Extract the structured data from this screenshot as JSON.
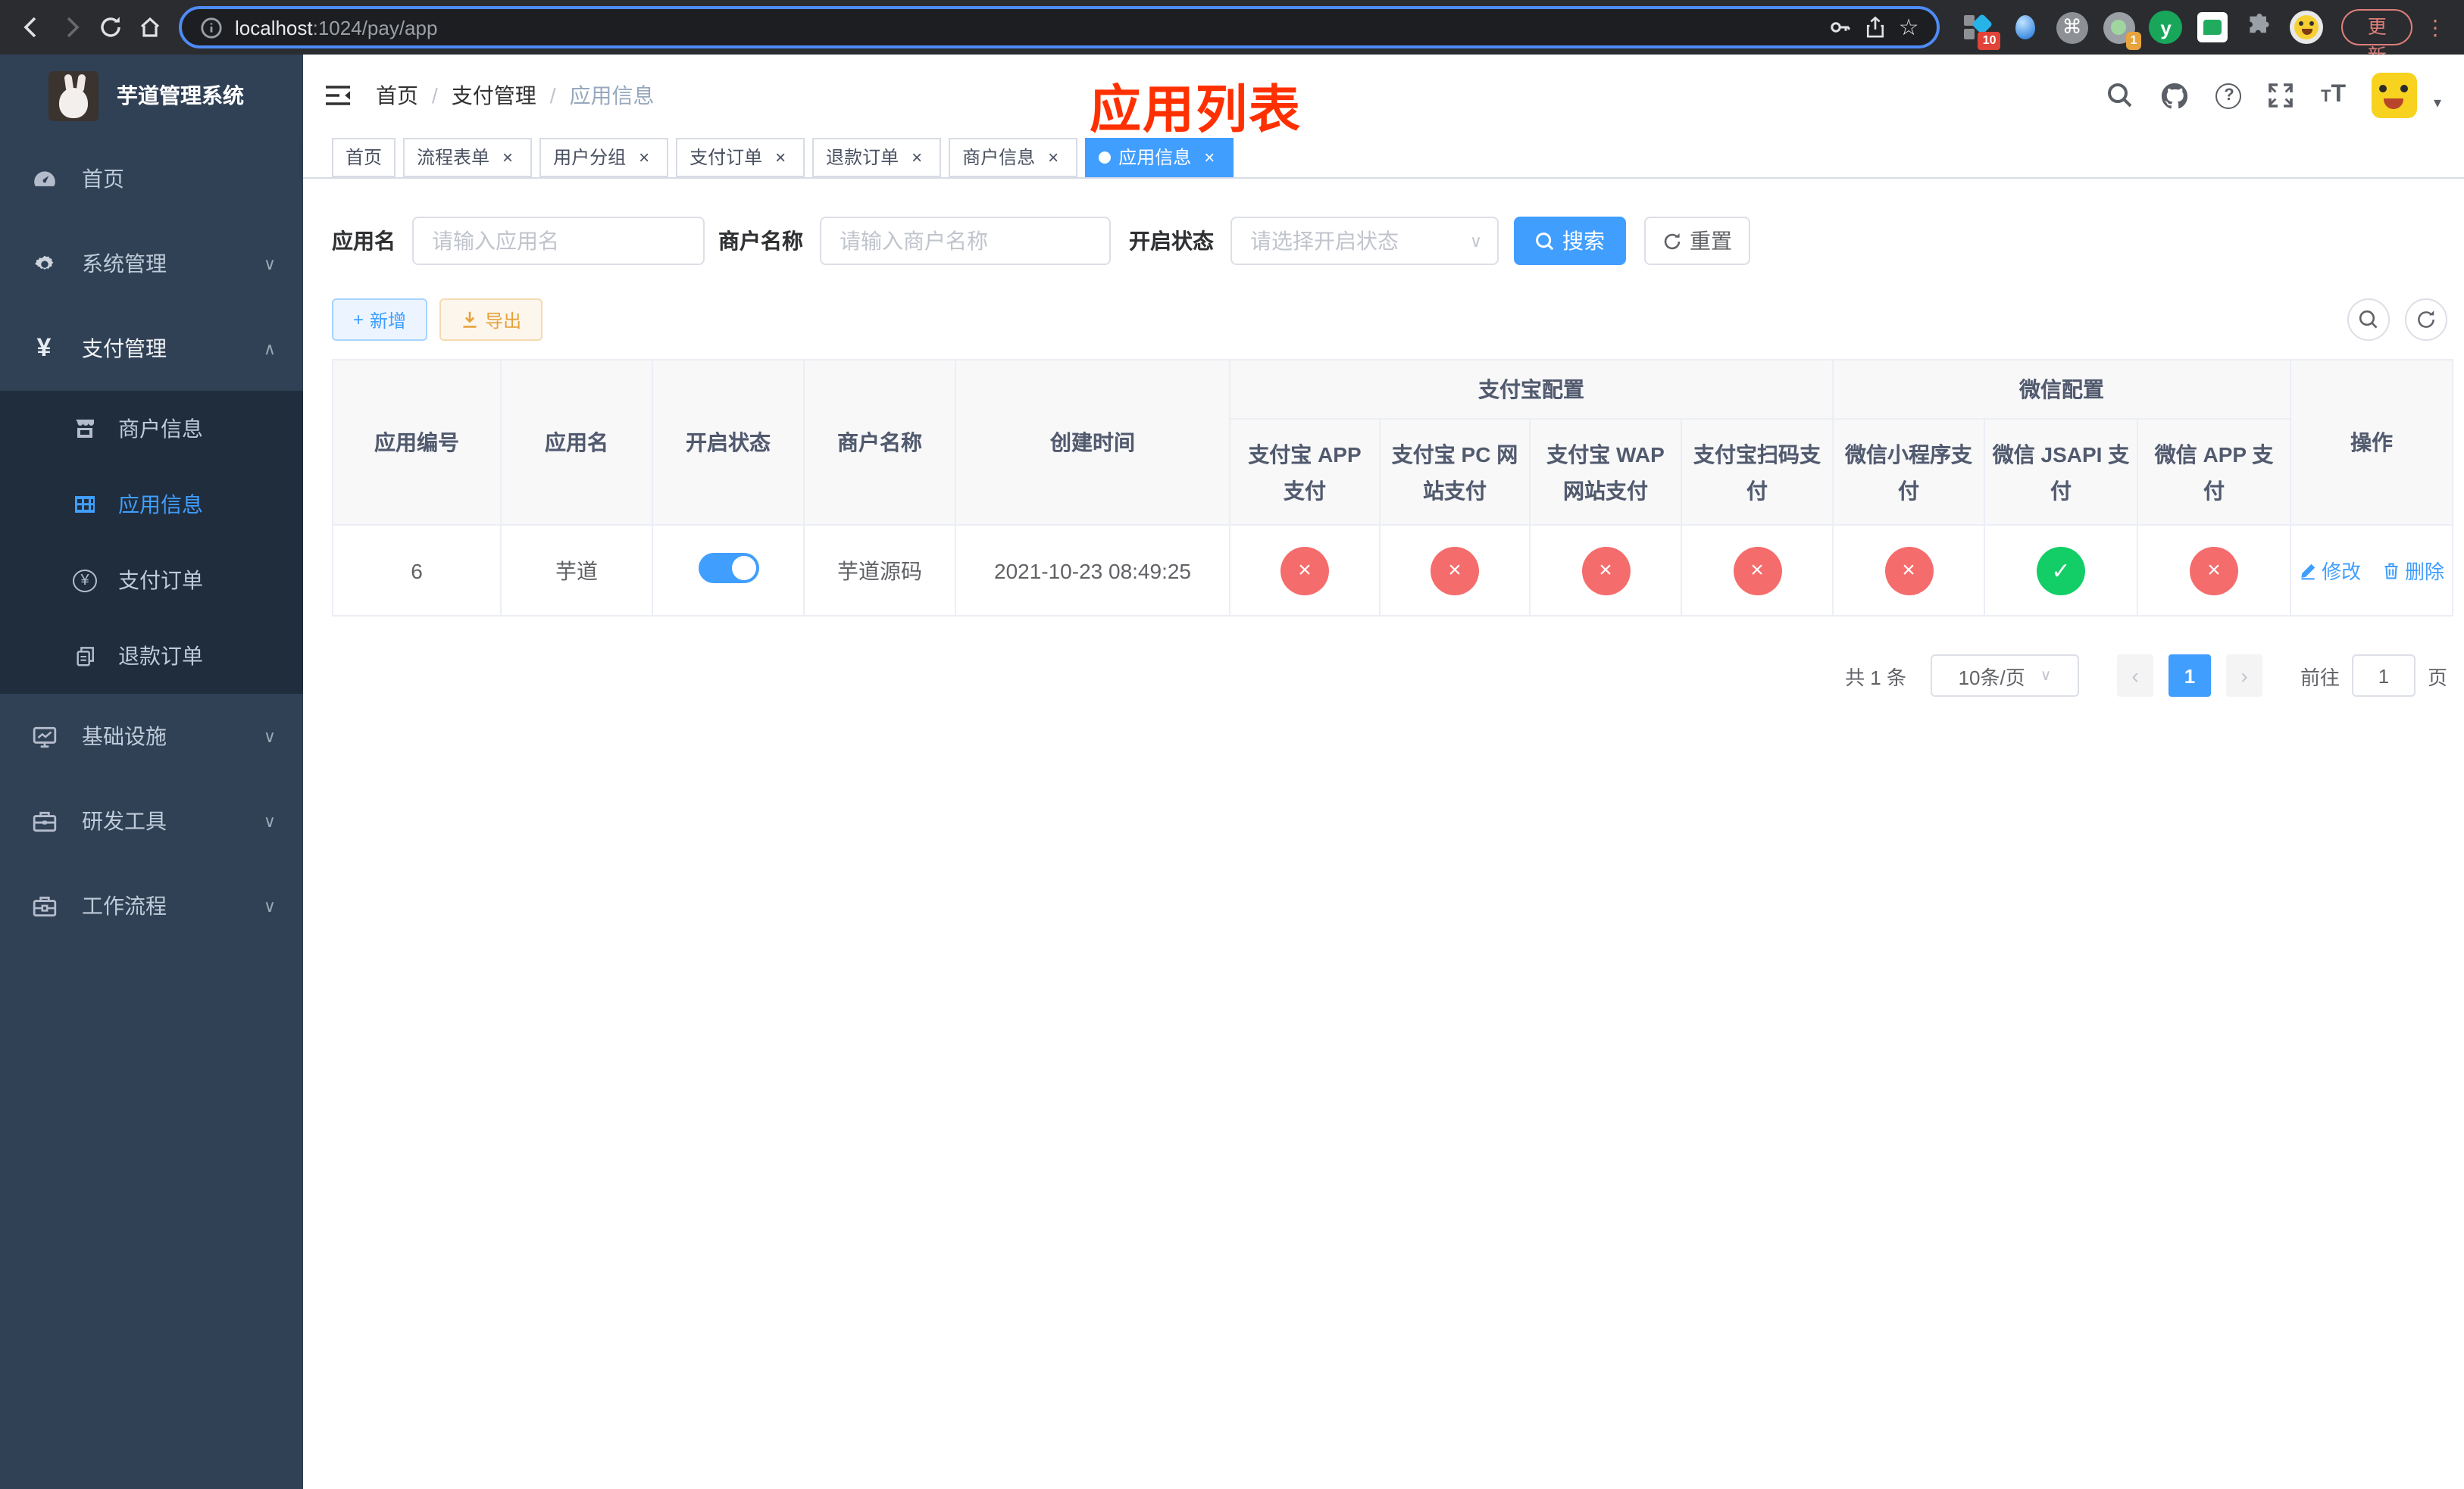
{
  "browser": {
    "url_host": "localhost",
    "url_path": ":1024/pay/app",
    "update_label": "更新",
    "ext_badge_blue": "10",
    "ext_badge_camera": "1",
    "ext_y_label": "y"
  },
  "icons": {
    "close": "×",
    "dropdown_arrow": "∨",
    "expand_arrow": "∧",
    "prev": "‹",
    "next": "›",
    "kebab": "⋮",
    "command": "⌘",
    "star": "☆",
    "plus": "+",
    "question": "?",
    "yen": "¥",
    "fontsize": "TT",
    "caret_down": "▾"
  },
  "sidebar": {
    "logo_title": "芋道管理系统",
    "menu": [
      {
        "label": "首页"
      },
      {
        "label": "系统管理"
      },
      {
        "label": "支付管理"
      },
      {
        "label": "基础设施"
      },
      {
        "label": "研发工具"
      },
      {
        "label": "工作流程"
      }
    ],
    "submenu": [
      {
        "label": "商户信息"
      },
      {
        "label": "应用信息"
      },
      {
        "label": "支付订单"
      },
      {
        "label": "退款订单"
      }
    ]
  },
  "header": {
    "breadcrumb": [
      "首页",
      "支付管理",
      "应用信息"
    ],
    "page_title": "应用列表"
  },
  "tabs": [
    {
      "label": "首页",
      "closable": false,
      "active": false
    },
    {
      "label": "流程表单",
      "closable": true,
      "active": false
    },
    {
      "label": "用户分组",
      "closable": true,
      "active": false
    },
    {
      "label": "支付订单",
      "closable": true,
      "active": false
    },
    {
      "label": "退款订单",
      "closable": true,
      "active": false
    },
    {
      "label": "商户信息",
      "closable": true,
      "active": false
    },
    {
      "label": "应用信息",
      "closable": true,
      "active": true
    }
  ],
  "filters": {
    "app_name_label": "应用名",
    "app_name_placeholder": "请输入应用名",
    "merchant_label": "商户名称",
    "merchant_placeholder": "请输入商户名称",
    "status_label": "开启状态",
    "status_placeholder": "请选择开启状态",
    "search_label": "搜索",
    "reset_label": "重置"
  },
  "toolbar": {
    "add_label": "新增",
    "export_label": "导出"
  },
  "table": {
    "headers": {
      "app_id": "应用编号",
      "app_name": "应用名",
      "status": "开启状态",
      "merchant": "商户名称",
      "create_time": "创建时间",
      "alipay_group": "支付宝配置",
      "wechat_group": "微信配置",
      "alipay_cols": [
        "支付宝 APP 支付",
        "支付宝 PC 网站支付",
        "支付宝 WAP 网站支付",
        "支付宝扫码支付"
      ],
      "wechat_cols": [
        "微信小程序支付",
        "微信 JSAPI 支付",
        "微信 APP 支付"
      ],
      "operation": "操作"
    },
    "row": {
      "app_id": "6",
      "app_name": "芋道",
      "status_enabled": true,
      "merchant": "芋道源码",
      "create_time": "2021-10-23 08:49:25",
      "pay_channels": [
        {
          "name": "支付宝 APP 支付",
          "enabled": false,
          "glyph": "×"
        },
        {
          "name": "支付宝 PC 网站支付",
          "enabled": false,
          "glyph": "×"
        },
        {
          "name": "支付宝 WAP 网站支付",
          "enabled": false,
          "glyph": "×"
        },
        {
          "name": "支付宝扫码支付",
          "enabled": false,
          "glyph": "×"
        },
        {
          "name": "微信小程序支付",
          "enabled": false,
          "glyph": "×"
        },
        {
          "name": "微信 JSAPI 支付",
          "enabled": true,
          "glyph": "✓"
        },
        {
          "name": "微信 APP 支付",
          "enabled": false,
          "glyph": "×"
        }
      ],
      "edit_label": "修改",
      "delete_label": "删除"
    }
  },
  "pagination": {
    "total_text": "共 1 条",
    "page_size": "10条/页",
    "current_page": "1",
    "goto_label": "前往",
    "goto_value": "1",
    "goto_suffix": "页"
  },
  "colors": {
    "accent": "#409eff",
    "success": "#13ce66",
    "danger": "#f56c6c",
    "title_red": "#ff3000",
    "sidebar_bg": "#304156",
    "submenu_bg": "#1f2d3d"
  }
}
